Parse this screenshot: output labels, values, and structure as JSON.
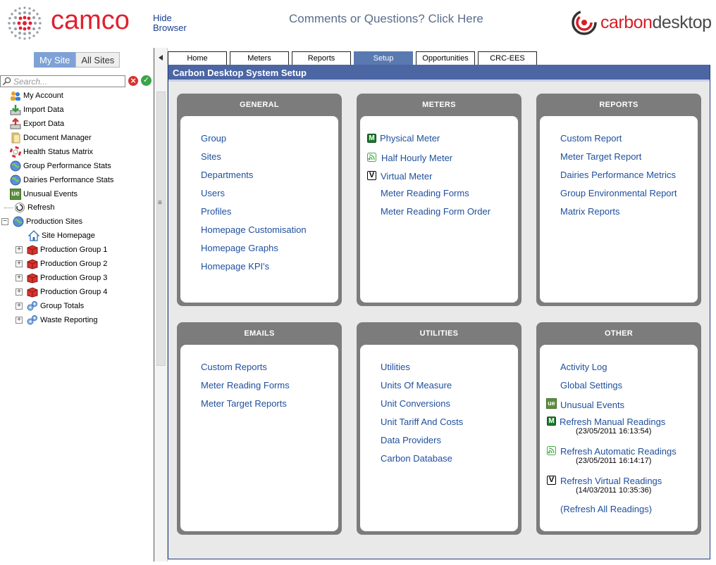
{
  "header": {
    "camco_logo": "camco",
    "hide_browser": "Hide Browser",
    "comments_link": "Comments or Questions? Click Here",
    "carbondesktop_logo_a": "carbon",
    "carbondesktop_logo_b": "desktop"
  },
  "sidebar": {
    "tabs": [
      "My Site",
      "All Sites"
    ],
    "search_placeholder": "Search...",
    "items": [
      {
        "label": "My Account",
        "icon": "users-icon"
      },
      {
        "label": "Import Data",
        "icon": "import-icon"
      },
      {
        "label": "Export Data",
        "icon": "export-icon"
      },
      {
        "label": "Document Manager",
        "icon": "document-icon"
      },
      {
        "label": "Health Status Matrix",
        "icon": "lifebuoy-icon"
      },
      {
        "label": "Group Performance Stats",
        "icon": "globe-icon"
      },
      {
        "label": "Dairies Performance Stats",
        "icon": "globe-icon"
      },
      {
        "label": "Unusual Events",
        "icon": "ue-icon"
      },
      {
        "label": "Refresh",
        "icon": "refresh-icon"
      },
      {
        "label": "Production Sites",
        "icon": "globe-icon"
      },
      {
        "label": "Site Homepage",
        "icon": "home-icon"
      },
      {
        "label": "Production Group 1",
        "icon": "box-icon"
      },
      {
        "label": "Production Group 2",
        "icon": "box-icon"
      },
      {
        "label": "Production Group 3",
        "icon": "box-icon"
      },
      {
        "label": "Production Group 4",
        "icon": "box-icon"
      },
      {
        "label": "Group Totals",
        "icon": "gears-icon"
      },
      {
        "label": "Waste Reporting",
        "icon": "gears-icon"
      }
    ]
  },
  "main": {
    "tabs": [
      "Home",
      "Meters",
      "Reports",
      "Setup",
      "Opportunities",
      "CRC-EES"
    ],
    "active_tab": "Setup",
    "title": "Carbon Desktop System Setup",
    "panels": {
      "general": {
        "title": "GENERAL",
        "links": [
          "Group",
          "Sites",
          "Departments",
          "Users",
          "Profiles",
          "Homepage Customisation",
          "Homepage Graphs",
          "Homepage KPI's"
        ]
      },
      "meters": {
        "title": "METERS",
        "links": [
          "Physical Meter",
          "Half Hourly Meter",
          "Virtual Meter",
          "Meter Reading Forms",
          "Meter Reading Form Order"
        ]
      },
      "reports": {
        "title": "REPORTS",
        "links": [
          "Custom Report",
          "Meter Target Report",
          "Dairies Performance Metrics",
          "Group Environmental Report",
          "Matrix Reports"
        ]
      },
      "emails": {
        "title": "EMAILS",
        "links": [
          "Custom Reports",
          "Meter Reading Forms",
          "Meter Target Reports"
        ]
      },
      "utilities": {
        "title": "UTILITIES",
        "links": [
          "Utilities",
          "Units Of Measure",
          "Unit Conversions",
          "Unit Tariff And Costs",
          "Data Providers",
          "Carbon Database"
        ]
      },
      "other": {
        "title": "OTHER",
        "links": [
          "Activity Log",
          "Global Settings",
          "Unusual Events",
          "Refresh Manual Readings",
          "Refresh Automatic Readings",
          "Refresh Virtual Readings",
          "(Refresh All Readings)"
        ],
        "timestamps": [
          "(23/05/2011 16:13:54)",
          "(23/05/2011 16:14:17)",
          "(14/03/2011 10:35:36)"
        ]
      }
    }
  },
  "colors": {
    "camco_red": "#e0202f",
    "link_blue": "#1e4f9c",
    "title_bar": "#4b66a3",
    "active_tab": "#5a79b1",
    "panel_grey": "#7c7c7c"
  }
}
